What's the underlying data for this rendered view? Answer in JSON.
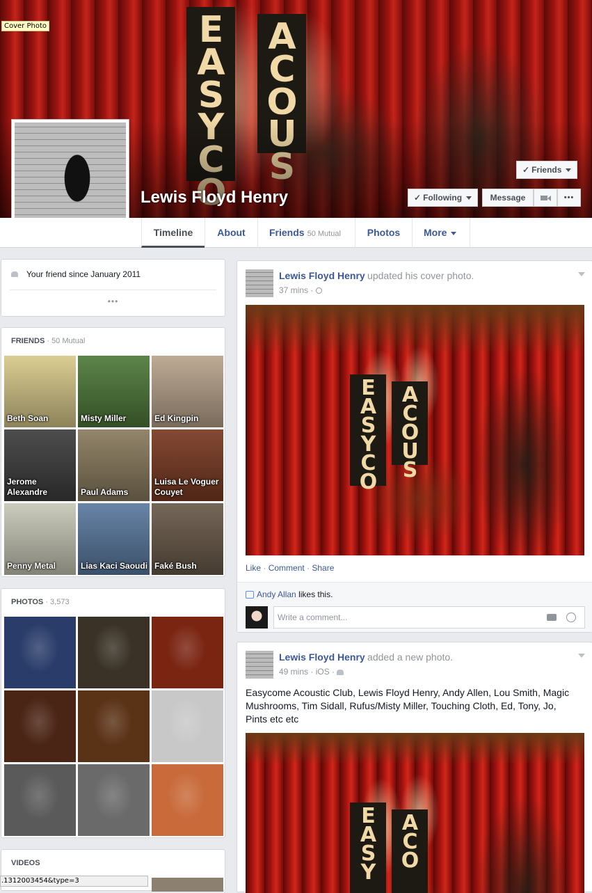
{
  "cover": {
    "tooltip": "Cover Photo",
    "banner_left": "E A S Y C O M E",
    "banner_right": "A C O U S"
  },
  "profile": {
    "name": "Lewis Floyd Henry"
  },
  "actions": {
    "friends_label": "Friends",
    "following_label": "Following",
    "message_label": "Message",
    "more_glyph": "•••"
  },
  "nav": {
    "tabs": [
      {
        "label": "Timeline",
        "sub": ""
      },
      {
        "label": "About",
        "sub": ""
      },
      {
        "label": "Friends",
        "sub": "50 Mutual"
      },
      {
        "label": "Photos",
        "sub": ""
      },
      {
        "label": "More",
        "sub": ""
      }
    ]
  },
  "intro": {
    "friend_since": "Your friend since January 2011",
    "more": "•••"
  },
  "friends": {
    "header": "FRIENDS",
    "count": "50 Mutual",
    "items": [
      {
        "name": "Beth Soan",
        "color": "#d8c98a"
      },
      {
        "name": "Misty Miller",
        "color": "#4f7a3a"
      },
      {
        "name": "Ed Kingpin",
        "color": "#b9a48c"
      },
      {
        "name": "Jerome Alexandre",
        "color": "#3e3e3e"
      },
      {
        "name": "Paul Adams",
        "color": "#8a7b5e"
      },
      {
        "name": "Luisa Le Voguer Couyet",
        "color": "#7a3a22"
      },
      {
        "name": "Penny Metal",
        "color": "#c8c8b8"
      },
      {
        "name": "Lias Kaci Saoudi",
        "color": "#5b7aa0"
      },
      {
        "name": "Faké Bush",
        "color": "#6a5a4a"
      }
    ]
  },
  "photos": {
    "header": "PHOTOS",
    "count": "3,573",
    "colors": [
      "#2a3d6a",
      "#3a3226",
      "#7a2412",
      "#4a2414",
      "#5a3216",
      "#c8c8c8",
      "#5a5a5a",
      "#6a6a6a",
      "#c86a3a"
    ]
  },
  "videos": {
    "header": "VIDEOS"
  },
  "status_url": ".1312003454&type=3",
  "posts": [
    {
      "author": "Lewis Floyd Henry",
      "action": "updated his cover photo.",
      "time": "37 mins",
      "audience_icon": "globe-icon",
      "like": "Like",
      "comment": "Comment",
      "share": "Share",
      "liker": "Andy Allan",
      "likes_text": "likes this.",
      "comment_placeholder": "Write a comment..."
    },
    {
      "author": "Lewis Floyd Henry",
      "action": "added a new photo.",
      "time": "49 mins",
      "via": "iOS",
      "audience_icon": "friends-icon",
      "text": "Easycome Acoustic Club, Lewis Floyd Henry, Andy Allen, Lou Smith, Magic Mushrooms, Tim Sidall, Rufus/Misty Miller, Touching Cloth, Ed, Tony, Jo, Pints etc etc"
    }
  ]
}
